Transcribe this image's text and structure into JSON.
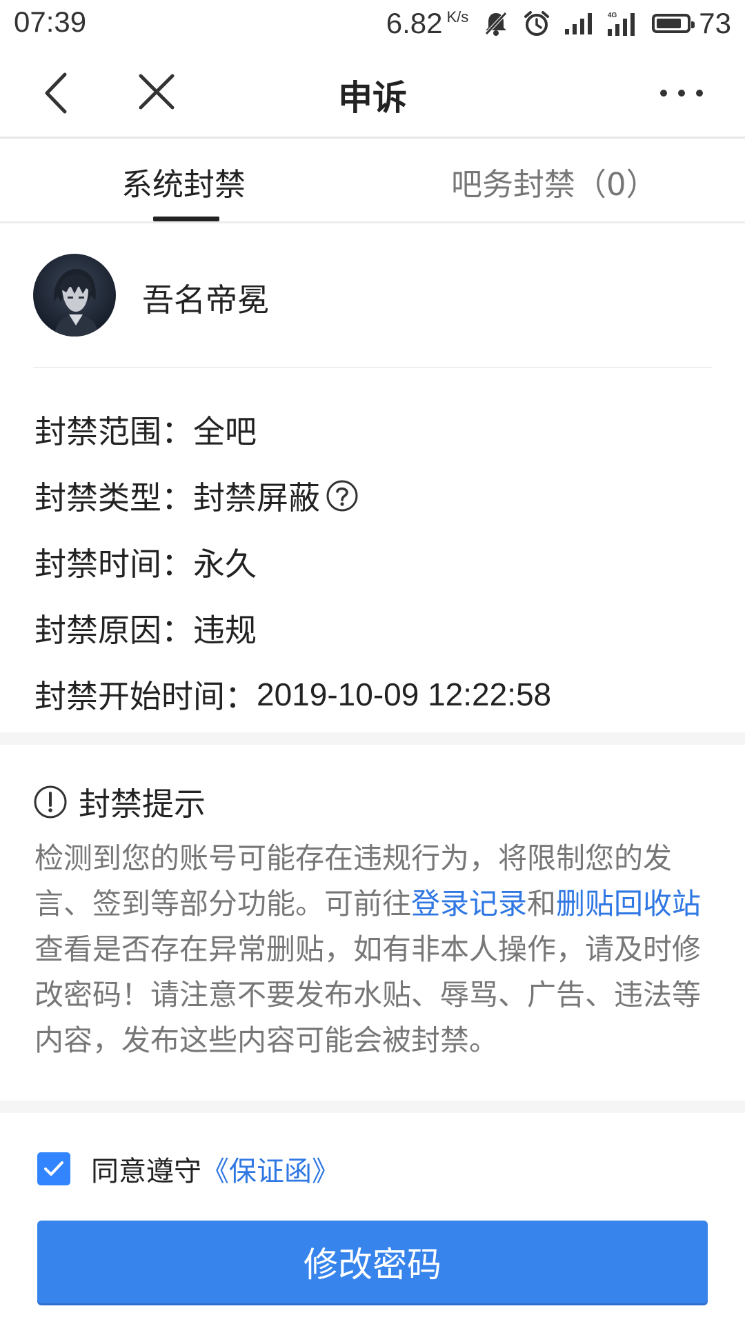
{
  "status_bar": {
    "time": "07:39",
    "network_speed": "6.82",
    "network_speed_unit": "K/s",
    "network_type": "4G",
    "battery": "73"
  },
  "nav": {
    "title": "申诉"
  },
  "tabs": [
    {
      "label": "系统封禁",
      "active": true
    },
    {
      "label": "吧务封禁（0）",
      "active": false
    }
  ],
  "profile": {
    "username": "吾名帝冕"
  },
  "ban_info": [
    {
      "label": "封禁范围：",
      "value": "全吧"
    },
    {
      "label": "封禁类型：",
      "value": "封禁屏蔽"
    },
    {
      "label": "封禁时间：",
      "value": "永久"
    },
    {
      "label": "封禁原因：",
      "value": "违规"
    },
    {
      "label": "封禁开始时间：",
      "value": "2019-10-09 12:22:58"
    }
  ],
  "notice": {
    "title": "封禁提示",
    "line1": "检测到您的账号可能存在违规行为，将限制您的发",
    "line2_pre": "言、签到等部分功能。可前往",
    "link_login_records": "登录记录",
    "line2_and": "和",
    "link_recycle_bin": "删贴回收站",
    "line3": "查看是否存在异常删贴，如有非本人操作，请及时修",
    "line4": "改密码！请注意不要发布水贴、辱骂、广告、违法等",
    "line5": "内容，发布这些内容可能会被封禁。"
  },
  "agreement": {
    "checked": true,
    "text": "同意遵守",
    "link": "《保证函》"
  },
  "primary_button": {
    "label": "修改密码"
  },
  "colors": {
    "accent": "#3784ec",
    "link": "#2f77e3",
    "checkbox": "#3385ff"
  }
}
